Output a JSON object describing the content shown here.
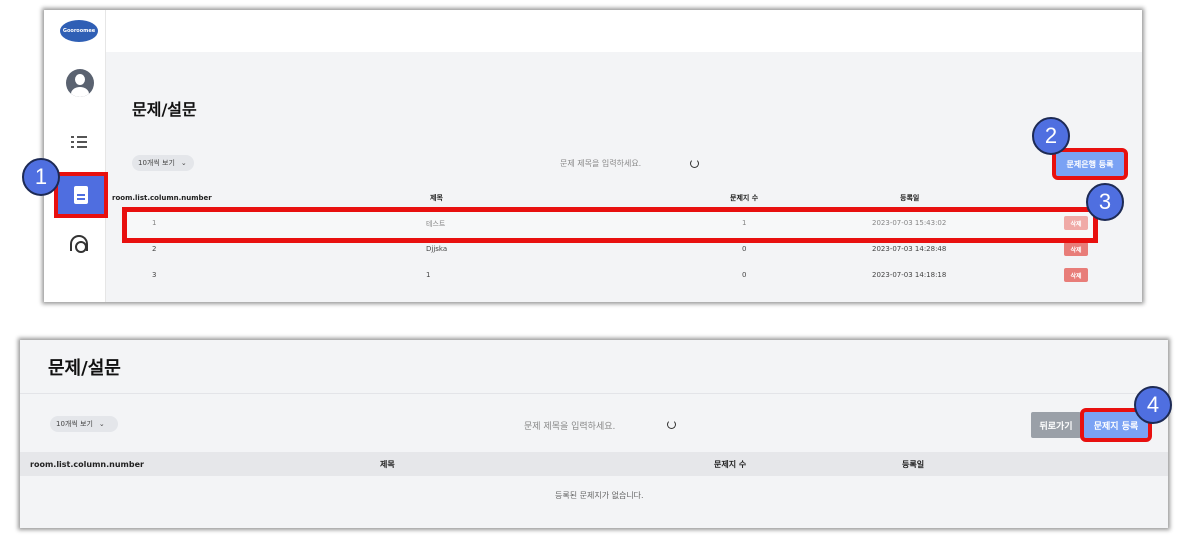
{
  "panel1": {
    "logo_text": "Gooroomee",
    "page_title": "문제/설문",
    "page_size": "10개씩 보기",
    "search_placeholder": "문제 제목을 입력하세요.",
    "register_bank_button": "문제은행 등록",
    "columns": [
      "room.list.column.number",
      "제목",
      "문제지 수",
      "등록일"
    ],
    "rows": [
      {
        "number": "1",
        "title": "테스트",
        "count": "1",
        "date": "2023-07-03 15:43:02",
        "action": "삭제"
      },
      {
        "number": "2",
        "title": "Djjska",
        "count": "0",
        "date": "2023-07-03 14:28:48",
        "action": "삭제"
      },
      {
        "number": "3",
        "title": "1",
        "count": "0",
        "date": "2023-07-03 14:18:18",
        "action": "삭제"
      }
    ]
  },
  "panel2": {
    "page_title": "문제/설문",
    "page_size": "10개씩 보기",
    "search_placeholder": "문제 제목을 입력하세요.",
    "back_button": "뒤로가기",
    "register_sheet_button": "문제지 등록",
    "columns": [
      "room.list.column.number",
      "제목",
      "문제지 수",
      "등록일"
    ],
    "empty_message": "등록된 문제지가 없습니다."
  },
  "badges": [
    "1",
    "2",
    "3",
    "4"
  ],
  "colors": {
    "highlight": "#e8100f",
    "primary_button": "#7aa2f4",
    "delete_button": "#e87d79",
    "badge": "#4f6fe0",
    "sidebar_active": "#4f6ee0"
  }
}
